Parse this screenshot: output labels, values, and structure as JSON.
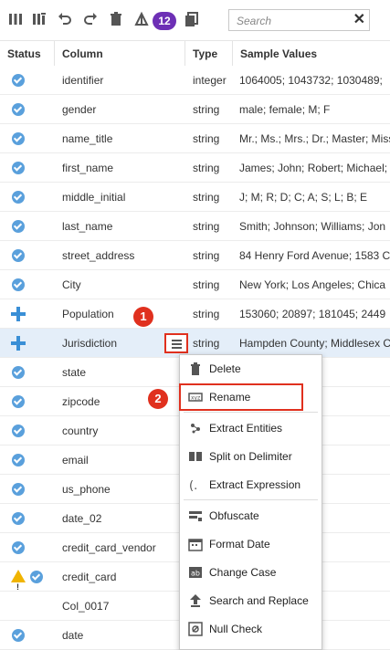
{
  "toolbar": {
    "badge_count": "12",
    "search_placeholder": "Search",
    "clear_glyph": "✕"
  },
  "table": {
    "headers": {
      "status": "Status",
      "column": "Column",
      "type": "Type",
      "sample": "Sample Values"
    },
    "rows": [
      {
        "status": "check",
        "name": "identifier",
        "type": "integer",
        "sample": "1064005; 1043732; 1030489;"
      },
      {
        "status": "check",
        "name": "gender",
        "type": "string",
        "sample": "male; female; M; F"
      },
      {
        "status": "check",
        "name": "name_title",
        "type": "string",
        "sample": "Mr.; Ms.; Mrs.; Dr.; Master; Miss"
      },
      {
        "status": "check",
        "name": "first_name",
        "type": "string",
        "sample": "James; John; Robert; Michael;"
      },
      {
        "status": "check",
        "name": "middle_initial",
        "type": "string",
        "sample": "J; M; R; D; C; A; S; L; B; E"
      },
      {
        "status": "check",
        "name": "last_name",
        "type": "string",
        "sample": "Smith; Johnson; Williams; Jon"
      },
      {
        "status": "check",
        "name": "street_address",
        "type": "string",
        "sample": "84 Henry Ford Avenue; 1583 C"
      },
      {
        "status": "check",
        "name": "City",
        "type": "string",
        "sample": "New York; Los Angeles; Chica"
      },
      {
        "status": "plus",
        "name": "Population",
        "type": "string",
        "sample": "153060; 20897; 181045; 2449"
      },
      {
        "status": "plus",
        "name": "Jurisdiction",
        "type": "string",
        "sample": "Hampden County; Middlesex C"
      },
      {
        "status": "check",
        "name": "state",
        "type": "",
        "sample": "; PA; MI; OH; N"
      },
      {
        "status": "check",
        "name": "zipcode",
        "type": "",
        "sample": "9503; 48075;"
      },
      {
        "status": "check",
        "name": "country",
        "type": "",
        "sample": ""
      },
      {
        "status": "check",
        "name": "email",
        "type": "",
        "sample": "ail.com; Rober"
      },
      {
        "status": "check",
        "name": "us_phone",
        "type": "",
        "sample": "606-2443; 325"
      },
      {
        "status": "check",
        "name": "date_02",
        "type": "",
        "sample": "8/1928; 11/9/1"
      },
      {
        "status": "check",
        "name": "credit_card_vendor",
        "type": "",
        "sample": "d"
      },
      {
        "status": "warn",
        "name": "credit_card",
        "type": "",
        "sample": "3935; 4929700"
      },
      {
        "status": "none",
        "name": "Col_0017",
        "type": "",
        "sample": "15; 393; 190; 1"
      },
      {
        "status": "check",
        "name": "date",
        "type": "",
        "sample": "12/2018; 6/20"
      }
    ]
  },
  "context_menu": {
    "items": [
      {
        "label": "Delete",
        "icon": "trash-icon"
      },
      {
        "label": "Rename",
        "icon": "rename-icon"
      },
      {
        "label": "Extract Entities",
        "icon": "extract-entities-icon"
      },
      {
        "label": "Split on Delimiter",
        "icon": "split-icon"
      },
      {
        "label": "Extract Expression",
        "icon": "expression-icon"
      },
      {
        "label": "Obfuscate",
        "icon": "obfuscate-icon"
      },
      {
        "label": "Format Date",
        "icon": "calendar-icon"
      },
      {
        "label": "Change Case",
        "icon": "change-case-icon"
      },
      {
        "label": "Search and Replace",
        "icon": "search-replace-icon"
      },
      {
        "label": "Null Check",
        "icon": "null-check-icon"
      }
    ]
  },
  "callouts": {
    "one": "1",
    "two": "2"
  },
  "colors": {
    "accent": "#5aa0dc",
    "highlight": "#e0301e",
    "badge": "#6d2fb5",
    "selected_row": "#e4eef9"
  }
}
